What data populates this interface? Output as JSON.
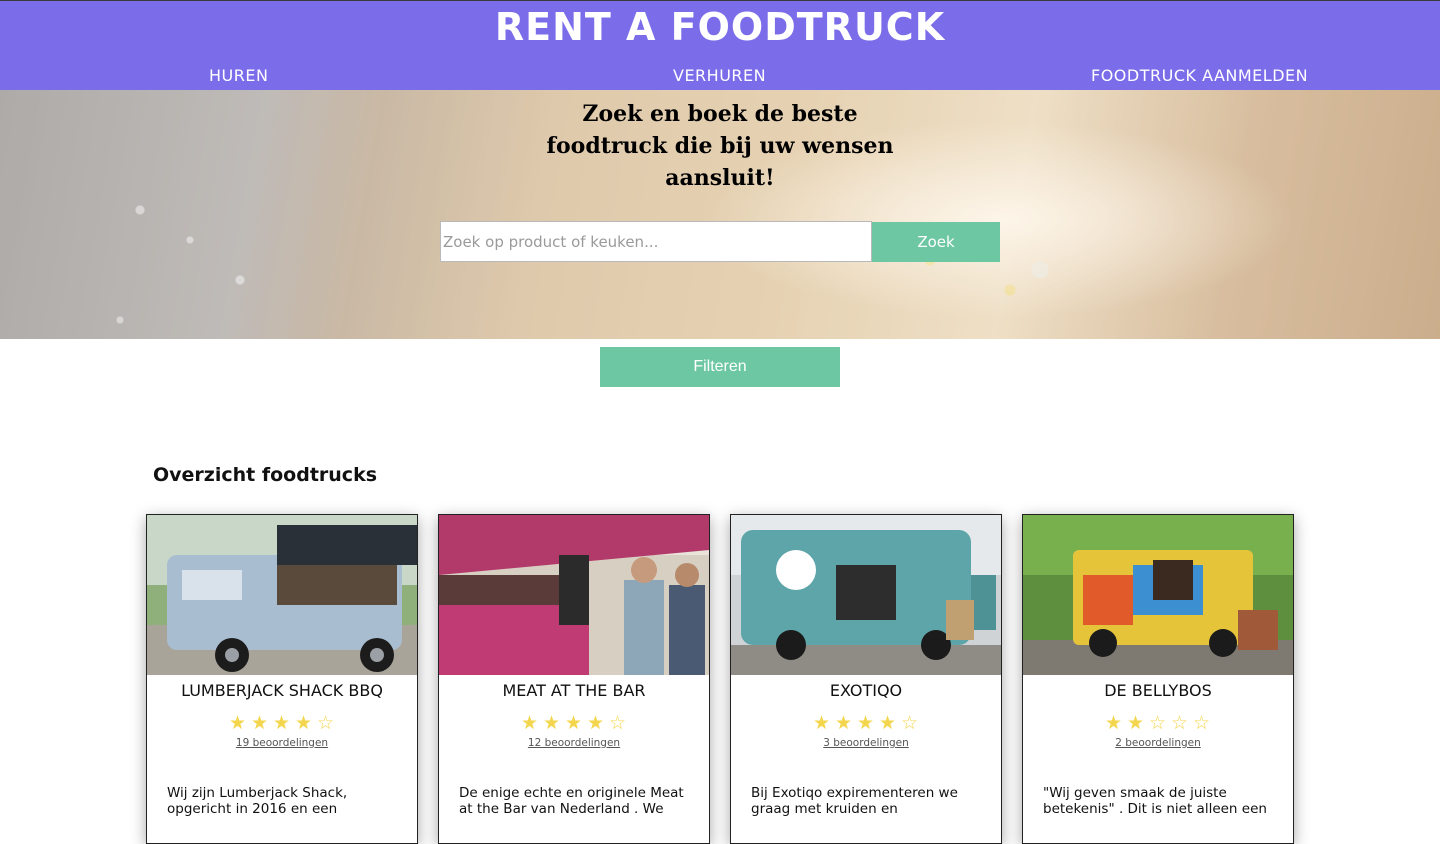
{
  "header": {
    "title": "RENT A FOODTRUCK",
    "nav": [
      "HUREN",
      "VERHUREN",
      "FOODTRUCK AANMELDEN"
    ]
  },
  "hero": {
    "title": "Zoek en boek de beste foodtruck die bij uw wensen aansluit!",
    "search_placeholder": "Zoek op product of keuken...",
    "search_button": "Zoek"
  },
  "filter_button": "Filteren",
  "overview_title": "Overzicht foodtrucks",
  "cards": [
    {
      "name": "LUMBERJACK SHACK BBQ",
      "rating": 4,
      "max_rating": 5,
      "reviews": "19 beoordelingen",
      "description": "Wij zijn Lumberjack Shack, opgericht in 2016 en een"
    },
    {
      "name": "MEAT AT THE BAR",
      "rating": 4,
      "max_rating": 5,
      "reviews": "12 beoordelingen",
      "description": "De enige echte en originele Meat at the Bar van Nederland . We"
    },
    {
      "name": "EXOTIQO",
      "rating": 4,
      "max_rating": 5,
      "reviews": "3 beoordelingen",
      "description": "Bij Exotiqo expirementeren we graag met kruiden en"
    },
    {
      "name": "DE BELLYBOS",
      "rating": 2,
      "max_rating": 5,
      "reviews": "2 beoordelingen",
      "description": "\"Wij geven smaak de juiste betekenis\" . Dit is niet alleen een"
    }
  ],
  "colors": {
    "header_bg": "#7b6cea",
    "accent": "#6dc7a3",
    "star": "#f4d64e"
  }
}
